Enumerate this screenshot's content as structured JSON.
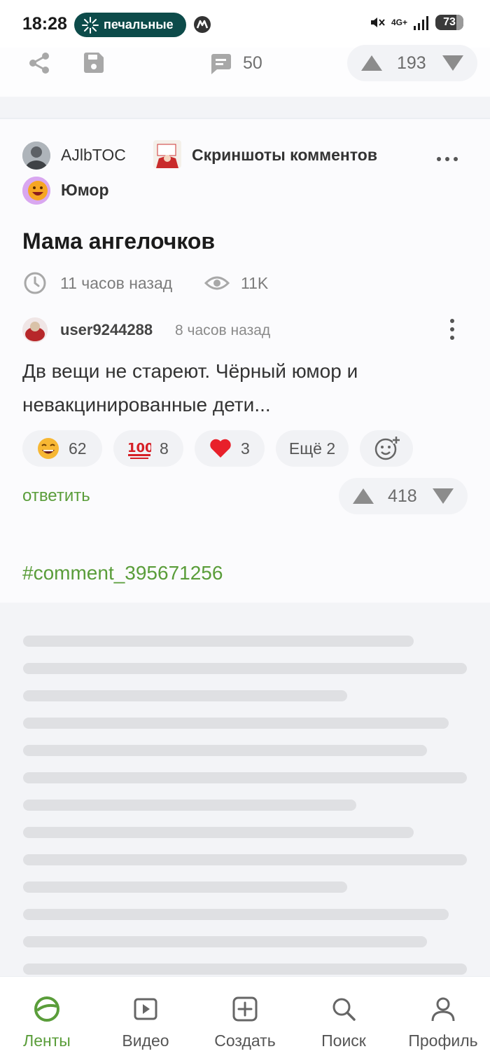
{
  "status_bar": {
    "time": "18:28",
    "notification_text": "печальные",
    "network": "4G+",
    "battery": "73"
  },
  "prev_post": {
    "comments_count": "50",
    "rating": "193"
  },
  "post": {
    "author": "AJlbTOC",
    "community": "Скриншоты комментов",
    "tag_community": "Юмор",
    "title": "Мама ангелочков",
    "time_ago": "11 часов назад",
    "views": "11K",
    "comment": {
      "user": "user9244288",
      "time_ago": "8 часов назад",
      "text": "Дв вещи не стареют. Чёрный юмор и невакцинированные дети...",
      "rating": "418",
      "reply_label": "ответить"
    },
    "reactions": [
      {
        "icon": "grinning-sweat-emoji",
        "count": "62"
      },
      {
        "icon": "hundred-points-emoji",
        "count": "8"
      },
      {
        "icon": "red-heart-emoji",
        "count": "3"
      }
    ],
    "more_reactions": "Ещё 2",
    "hashtag": "#comment_395671256"
  },
  "nav": {
    "items": [
      {
        "label": "Ленты",
        "icon": "feeds-icon"
      },
      {
        "label": "Видео",
        "icon": "video-icon"
      },
      {
        "label": "Создать",
        "icon": "create-icon"
      },
      {
        "label": "Поиск",
        "icon": "search-icon"
      },
      {
        "label": "Профиль",
        "icon": "profile-icon"
      }
    ],
    "active": "Ленты"
  },
  "colors": {
    "accent_green": "#5a9d3a",
    "pill_teal": "#0d4b4a",
    "background": "#f3f4f7"
  }
}
